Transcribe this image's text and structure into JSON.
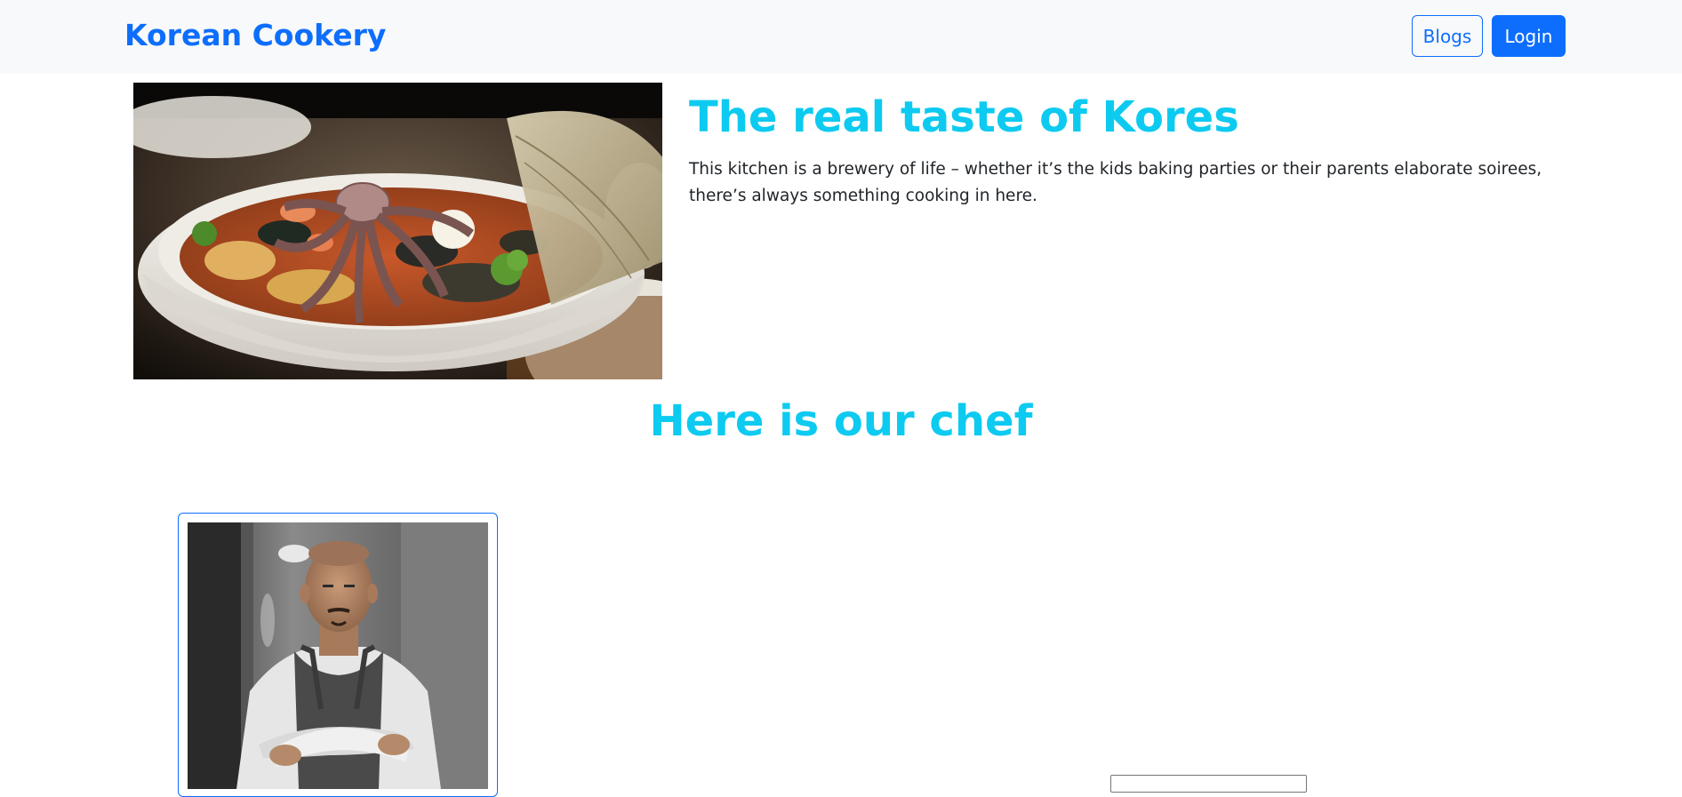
{
  "navbar": {
    "brand": "Korean Cookery",
    "blogs_label": "Blogs",
    "login_label": "Login"
  },
  "hero": {
    "image_alt": "Korean seafood noodle soup with octopus",
    "title": "The real taste of Kores",
    "text": "This kitchen is a brewery of life – whether it’s the kids baking parties or their parents elaborate soirees, there’s always something cooking in here."
  },
  "chef_section": {
    "heading": "Here is our chef",
    "chef_image_alt": "Chef in apron with arms crossed"
  },
  "colors": {
    "primary": "#0d6efd",
    "info": "#0dcaf0",
    "navbar_bg": "#f8f9fa"
  }
}
